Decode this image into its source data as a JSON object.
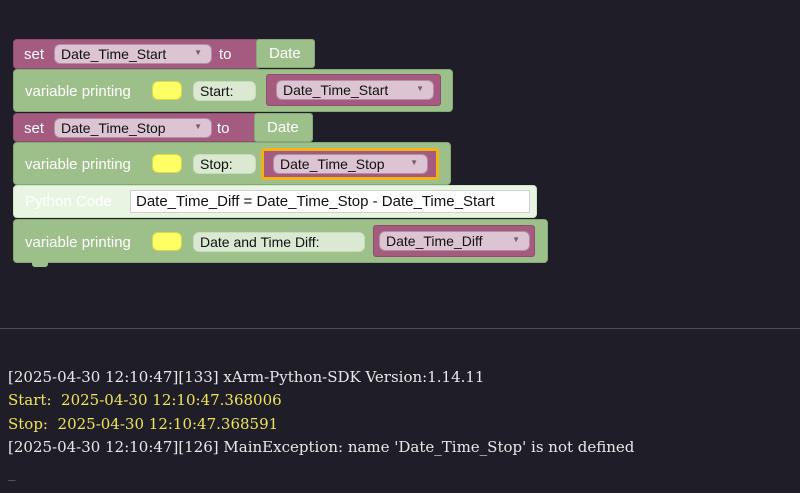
{
  "blocks": {
    "set_start": {
      "set": "set",
      "variable": "Date_Time_Start",
      "to": "to",
      "value": "Date"
    },
    "print_start": {
      "label": "variable printing",
      "text": "Start:",
      "variable": "Date_Time_Start"
    },
    "set_stop": {
      "set": "set",
      "variable": "Date_Time_Stop",
      "to": "to",
      "value": "Date"
    },
    "print_stop": {
      "label": "variable printing",
      "text": "Stop:",
      "variable": "Date_Time_Stop"
    },
    "python_code": {
      "label": "Python Code",
      "code": "Date_Time_Diff = Date_Time_Stop - Date_Time_Start"
    },
    "print_diff": {
      "label": "variable printing",
      "text": "Date and Time Diff:",
      "variable": "Date_Time_Diff"
    }
  },
  "console": {
    "lines": [
      "[2025-04-30 12:10:47][133] xArm-Python-SDK Version:1.14.11",
      "Start:  2025-04-30 12:10:47.368006",
      "Stop:  2025-04-30 12:10:47.368591",
      "[2025-04-30 12:10:47][126] MainException: name 'Date_Time_Stop' is not defined"
    ],
    "cursor": "_"
  },
  "colors": {
    "variable_block": "#a55b80",
    "text_block": "#9dc08b",
    "highlight": "#f2b316",
    "swatch": "#ffff66",
    "console_bg": "#1f1e28",
    "console_yellow": "#f0e35a"
  }
}
